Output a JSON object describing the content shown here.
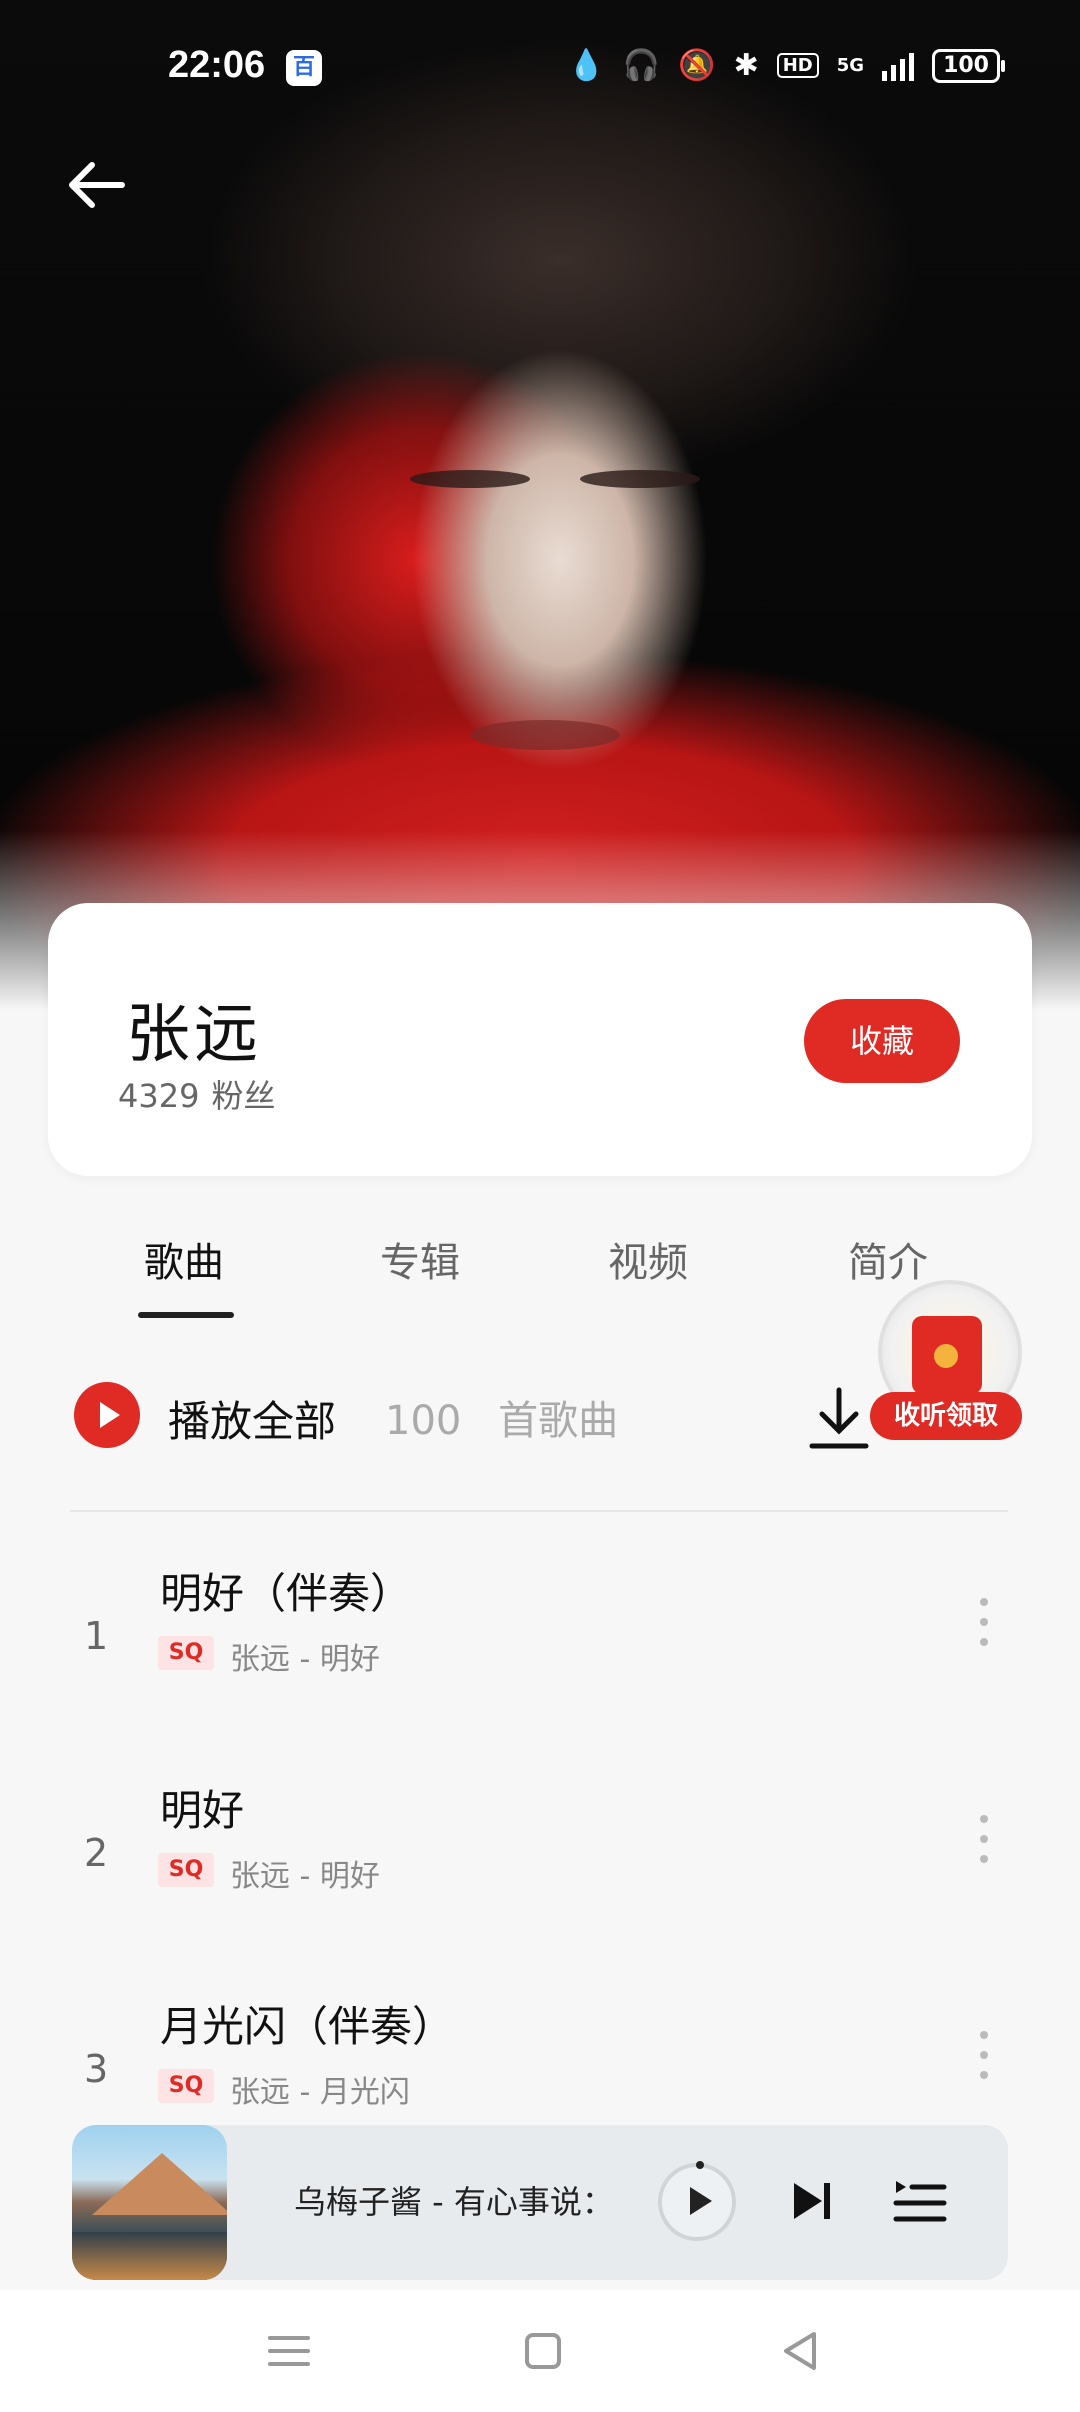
{
  "status_bar": {
    "time": "22:06",
    "app_badge": "百",
    "network": "5G",
    "hd": "HD",
    "battery": "100"
  },
  "artist": {
    "name": "张远",
    "fans_count": "4329",
    "fans_label": "粉丝",
    "favorite_label": "收藏"
  },
  "tabs": [
    {
      "label": "歌曲",
      "active": true
    },
    {
      "label": "专辑"
    },
    {
      "label": "视频"
    },
    {
      "label": "简介"
    }
  ],
  "play_all": {
    "label": "播放全部",
    "count": "100",
    "count_suffix": "首歌曲"
  },
  "promo": {
    "label": "收听领取"
  },
  "songs": [
    {
      "index": "1",
      "title": "明好（伴奏）",
      "quality": "SQ",
      "subtitle": "张远 - 明好"
    },
    {
      "index": "2",
      "title": "明好",
      "quality": "SQ",
      "subtitle": "张远 - 明好"
    },
    {
      "index": "3",
      "title": "月光闪（伴奏）",
      "quality": "SQ",
      "subtitle": "张远 - 月光闪"
    }
  ],
  "mini_player": {
    "now_playing": "乌梅子酱 - 有心事说：",
    "cover_icon": "mountain-lake-cover"
  },
  "colors": {
    "accent": "#e02b25",
    "background": "#f7f7f7"
  }
}
